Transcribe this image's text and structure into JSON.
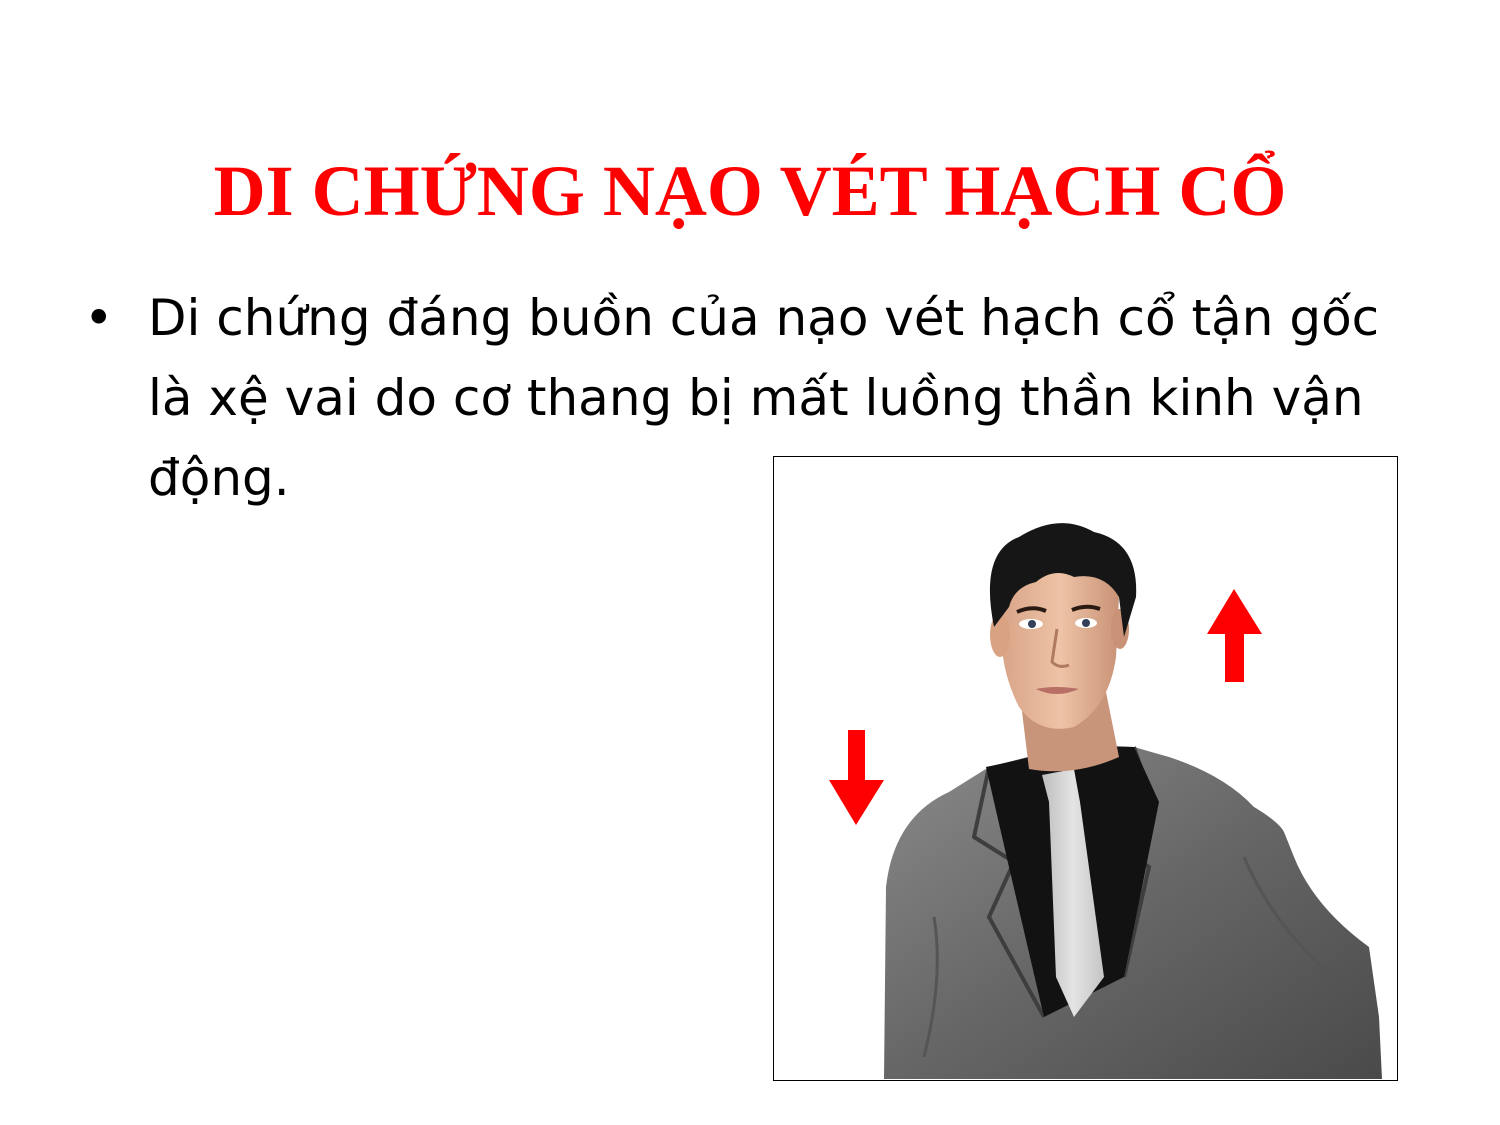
{
  "slide": {
    "title": "DI CHỨNG NẠO VÉT HẠCH CỔ",
    "bullets": [
      {
        "marker": "•",
        "text": "Di chứng đáng buồn của nạo vét hạch cổ tận gốc là xệ vai do cơ thang bị mất luồng thần kinh vận động."
      }
    ]
  },
  "colors": {
    "title": "#ff0000",
    "arrow": "#ff0000",
    "suit": "#6e6e6e",
    "tie": "#d6d6d6",
    "shirt": "#111111",
    "skin": "#e6b79a",
    "hair": "#151515"
  },
  "figure": {
    "subject": "man-in-suit-with-drooping-shoulder",
    "arrows": [
      "arrow-down-icon",
      "arrow-up-icon"
    ]
  }
}
